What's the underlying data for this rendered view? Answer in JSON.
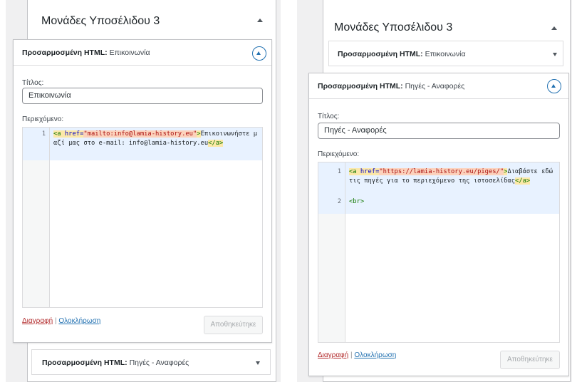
{
  "left": {
    "area_title": "Μονάδες Υποσέλιδου 3",
    "open_widget": {
      "type_label": "Προσαρμοσμένη HTML:",
      "name": "Επικοινωνία",
      "title_label": "Τίτλος:",
      "title_value": "Επικοινωνία",
      "content_label": "Περιεχόμενο:",
      "code": {
        "line1_num": "1",
        "tag_open": "<a",
        "attr": " href=",
        "href": "\"mailto:info@lamia-history.eu\"",
        "tag_close": ">",
        "text": "Επικοινωνήστε μαζί μας στο e-mail: info@lamia-history.eu",
        "end_tag": "</a>"
      },
      "delete_label": "Διαγραφή",
      "separator": "|",
      "done_label": "Ολοκλήρωση",
      "save_label": "Αποθηκεύτηκε"
    },
    "closed_widget": {
      "type_label": "Προσαρμοσμένη HTML:",
      "name": "Πηγές - Αναφορές"
    }
  },
  "right": {
    "area_title": "Μονάδες Υποσέλιδου 3",
    "closed_widget": {
      "type_label": "Προσαρμοσμένη HTML:",
      "name": "Επικοινωνία"
    },
    "open_widget": {
      "type_label": "Προσαρμοσμένη HTML:",
      "name": "Πηγές - Αναφορές",
      "title_label": "Τίτλος:",
      "title_value": "Πηγές - Αναφορές",
      "content_label": "Περιεχόμενο:",
      "code": {
        "line1_num": "1",
        "tag_open": "<a",
        "attr": " href=",
        "href": "\"https://lamia-history.eu/piges/\"",
        "tag_close": ">",
        "text": "Διαβάστε εδώ τις πηγές για το περιεχόμενο της ιστοσελίδας",
        "end_tag": "</a>",
        "line2_num": "2",
        "line2": "<br>"
      },
      "delete_label": "Διαγραφή",
      "separator": "|",
      "done_label": "Ολοκλήρωση",
      "save_label": "Αποθηκεύτηκε"
    }
  },
  "colors": {
    "accent": "#2271b1",
    "delete": "#b32d2e",
    "active_line": "#e8f2ff",
    "tag": "#117700",
    "string": "#aa1111"
  }
}
